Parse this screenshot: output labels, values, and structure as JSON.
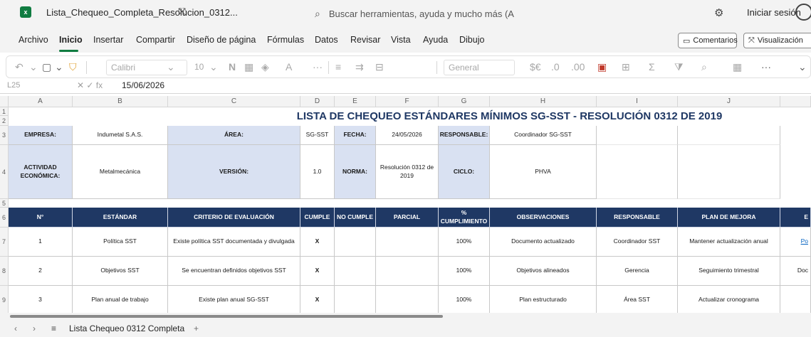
{
  "app": {
    "logo_text": "x",
    "document_title": "Lista_Chequeo_Completa_Resolucion_0312...",
    "search_placeholder": "Buscar herramientas, ayuda y mucho más (A",
    "signin_label": "Iniciar sesión"
  },
  "menu": {
    "items": [
      "Archivo",
      "Inicio",
      "Insertar",
      "Compartir",
      "Diseño de página",
      "Fórmulas",
      "Datos",
      "Revisar",
      "Vista",
      "Ayuda",
      "Dibujo"
    ],
    "active": "Inicio",
    "comments_label": "Comentarios",
    "view_label": "Visualización"
  },
  "ribbon": {
    "font_name": "Calibri",
    "font_size": "10",
    "bold_label": "N",
    "number_format": "General",
    "more_label": "···"
  },
  "formula_bar": {
    "cell_ref": "L25",
    "fx_label": "fx",
    "value": "15/06/2026"
  },
  "grid": {
    "columns": [
      "A",
      "B",
      "C",
      "D",
      "E",
      "F",
      "G",
      "H",
      "I",
      "J"
    ],
    "rows": [
      "1",
      "2",
      "3",
      "4",
      "5",
      "6",
      "7",
      "8",
      "9"
    ],
    "title": "LISTA DE CHEQUEO ESTÁNDARES MÍNIMOS SG-SST - RESOLUCIÓN 0312 DE 2019",
    "info": {
      "empresa_label": "EMPRESA:",
      "empresa_value": "Indumetal S.A.S.",
      "area_label": "ÁREA:",
      "area_value": "SG-SST",
      "fecha_label": "FECHA:",
      "fecha_value": "24/05/2026",
      "responsable_label": "RESPONSABLE:",
      "responsable_value": "Coordinador SG-SST",
      "actividad_label": "ACTIVIDAD ECONÓMICA:",
      "actividad_value": "Metalmecánica",
      "version_label": "VERSIÓN:",
      "version_value": "1.0",
      "norma_label": "NORMA:",
      "norma_value": "Resolución 0312 de 2019",
      "ciclo_label": "CICLO:",
      "ciclo_value": "PHVA"
    },
    "headers": [
      "N°",
      "ESTÁNDAR",
      "CRITERIO DE EVALUACIÓN",
      "CUMPLE",
      "NO CUMPLE",
      "PARCIAL",
      "% CUMPLIMIENTO",
      "OBSERVACIONES",
      "RESPONSABLE",
      "PLAN DE MEJORA",
      "E"
    ],
    "rows_data": [
      {
        "n": "1",
        "estandar": "Política SST",
        "criterio": "Existe política SST documentada y divulgada",
        "cumple": "X",
        "no_cumple": "",
        "parcial": "",
        "pct": "100%",
        "obs": "Documento actualizado",
        "resp": "Coordinador SST",
        "plan": "Mantener actualización anual",
        "extra": "Po"
      },
      {
        "n": "2",
        "estandar": "Objetivos SST",
        "criterio": "Se encuentran definidos objetivos SST",
        "cumple": "X",
        "no_cumple": "",
        "parcial": "",
        "pct": "100%",
        "obs": "Objetivos alineados",
        "resp": "Gerencia",
        "plan": "Seguimiento trimestral",
        "extra": "Doc"
      },
      {
        "n": "3",
        "estandar": "Plan anual de trabajo",
        "criterio": "Existe plan anual SG-SST",
        "cumple": "X",
        "no_cumple": "",
        "parcial": "",
        "pct": "100%",
        "obs": "Plan estructurado",
        "resp": "Área SST",
        "plan": "Actualizar cronograma",
        "extra": ""
      }
    ]
  },
  "sheets": {
    "active_name": "Lista Chequeo 0312 Completa",
    "add_label": "+"
  }
}
